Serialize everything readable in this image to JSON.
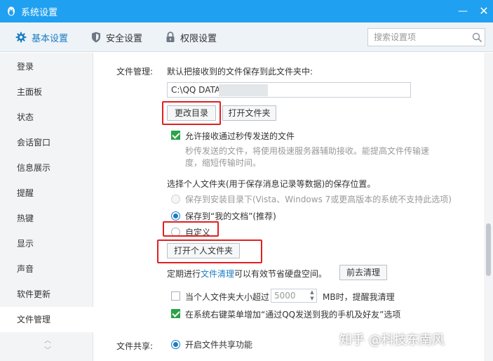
{
  "window": {
    "title": "系统设置",
    "min_glyph": "—",
    "close_glyph": "✕"
  },
  "tabs": [
    {
      "label": "基本设置",
      "icon": "gear-icon",
      "active": true
    },
    {
      "label": "安全设置",
      "icon": "shield-icon",
      "active": false
    },
    {
      "label": "权限设置",
      "icon": "lock-icon",
      "active": false
    }
  ],
  "search": {
    "placeholder": "搜索设置项",
    "value": ""
  },
  "sidebar": {
    "items": [
      "登录",
      "主面板",
      "状态",
      "会话窗口",
      "信息展示",
      "提醒",
      "热键",
      "显示",
      "声音",
      "软件更新",
      "文件管理"
    ],
    "active": "文件管理",
    "arrow_up": "︿",
    "arrow_down": "﹀"
  },
  "file_management": {
    "section_label": "文件管理:",
    "save_desc": "默认把接收到的文件保存到此文件夹中:",
    "path_value": "C:\\QQ DATA\\",
    "change_dir_button": "更改目录",
    "open_folder_button": "打开文件夹",
    "instant_transfer": {
      "checked": true,
      "label": "允许接收通过秒传发送的文件",
      "desc_line1": "秒传发送的文件，将使用极速服务器辅助接收。能提高文件传输速",
      "desc_line2": "度，缩短传输时间。"
    },
    "personal_folder_desc": "选择个人文件夹(用于保存消息记录等数据)的保存位置。",
    "radio_install_dir": "保存到安装目录下(Vista、Windows 7或更高版本的系统不支持此选项)",
    "radio_my_documents": "保存到“我的文档”(推荐)",
    "radio_custom": "自定义",
    "selected_radio": "保存到“我的文档”(推荐)",
    "open_personal_folder_button": "打开个人文件夹",
    "cleanup_prefix": "定期进行",
    "cleanup_link": "文件清理",
    "cleanup_suffix": "可以有效节省硬盘空间。",
    "cleanup_button": "前去清理",
    "size_limit": {
      "checked": false,
      "label_prefix": "当个人文件夹大小超过",
      "value": "5000",
      "label_suffix": "MB时，提醒我清理"
    },
    "context_menu": {
      "checked": true,
      "label": "在系统右键菜单增加“通过QQ发送到我的手机及好友”选项"
    }
  },
  "file_sharing": {
    "section_label": "文件共享:",
    "enable_label": "开启文件共享功能",
    "enabled": true
  },
  "watermark": "知乎 @科技东南风",
  "colors": {
    "titlebar": "#20a0f0",
    "accent": "#1a7dc4",
    "highlight": "#e02020",
    "check": "#2aa34a"
  }
}
